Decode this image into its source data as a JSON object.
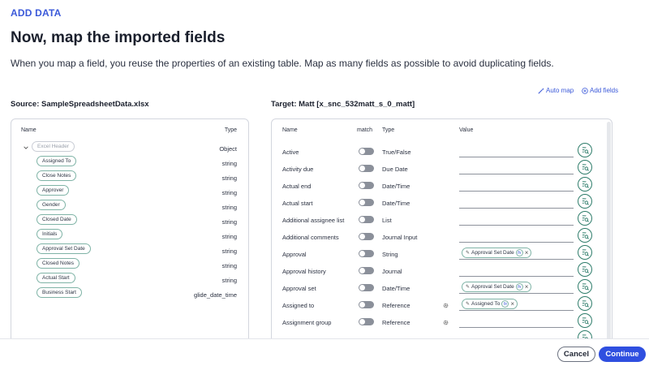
{
  "header": {
    "eyebrow": "ADD DATA",
    "title": "Now, map the imported fields",
    "subtitle": "When you map a field, you reuse the properties of an existing table. Map as many fields as possible to avoid duplicating fields."
  },
  "actions": {
    "auto_map": "Auto map",
    "add_fields": "Add fields"
  },
  "source": {
    "label": "Source: SampleSpreadsheetData.xlsx",
    "col_name": "Name",
    "col_type": "Type",
    "root": {
      "name": "Excel Header",
      "type": "Object"
    },
    "fields": [
      {
        "name": "Assigned To",
        "type": "string"
      },
      {
        "name": "Close Notes",
        "type": "string"
      },
      {
        "name": "Approver",
        "type": "string"
      },
      {
        "name": "Gender",
        "type": "string"
      },
      {
        "name": "Closed Date",
        "type": "string"
      },
      {
        "name": "Initials",
        "type": "string"
      },
      {
        "name": "Approval Set Date",
        "type": "string"
      },
      {
        "name": "Closed Notes",
        "type": "string"
      },
      {
        "name": "Actual Start",
        "type": "string"
      },
      {
        "name": "Business Start",
        "type": "glide_date_time"
      }
    ]
  },
  "target": {
    "label": "Target: Matt [x_snc_532matt_s_0_matt]",
    "col_name": "Name",
    "col_match": "match",
    "col_type": "Type",
    "col_value": "Value",
    "rows": [
      {
        "name": "Active",
        "type": "True/False",
        "value": ""
      },
      {
        "name": "Activity due",
        "type": "Due Date",
        "value": ""
      },
      {
        "name": "Actual end",
        "type": "Date/Time",
        "value": ""
      },
      {
        "name": "Actual start",
        "type": "Date/Time",
        "value": ""
      },
      {
        "name": "Additional assignee list",
        "type": "List",
        "value": ""
      },
      {
        "name": "Additional comments",
        "type": "Journal Input",
        "value": ""
      },
      {
        "name": "Approval",
        "type": "String",
        "value": "Approval Set Date"
      },
      {
        "name": "Approval history",
        "type": "Journal",
        "value": ""
      },
      {
        "name": "Approval set",
        "type": "Date/Time",
        "value": "Approval Set Date"
      },
      {
        "name": "Assigned to",
        "type": "Reference",
        "value": "Assigned To",
        "gear": true
      },
      {
        "name": "Assignment group",
        "type": "Reference",
        "value": "",
        "gear": true
      }
    ],
    "chip_fx": "fx"
  },
  "footer": {
    "cancel": "Cancel",
    "continue": "Continue"
  },
  "colors": {
    "accent": "#2f4fe0",
    "link": "#3b59d9",
    "pill_border": "#7fb3a6",
    "map_button": "#2f7d6b"
  },
  "icons": {
    "auto_map": "wand-icon",
    "add_fields": "plus-circle-icon",
    "map_button": "field-mapping-icon",
    "expand": "chevron-down-icon",
    "gear": "gear-icon"
  }
}
